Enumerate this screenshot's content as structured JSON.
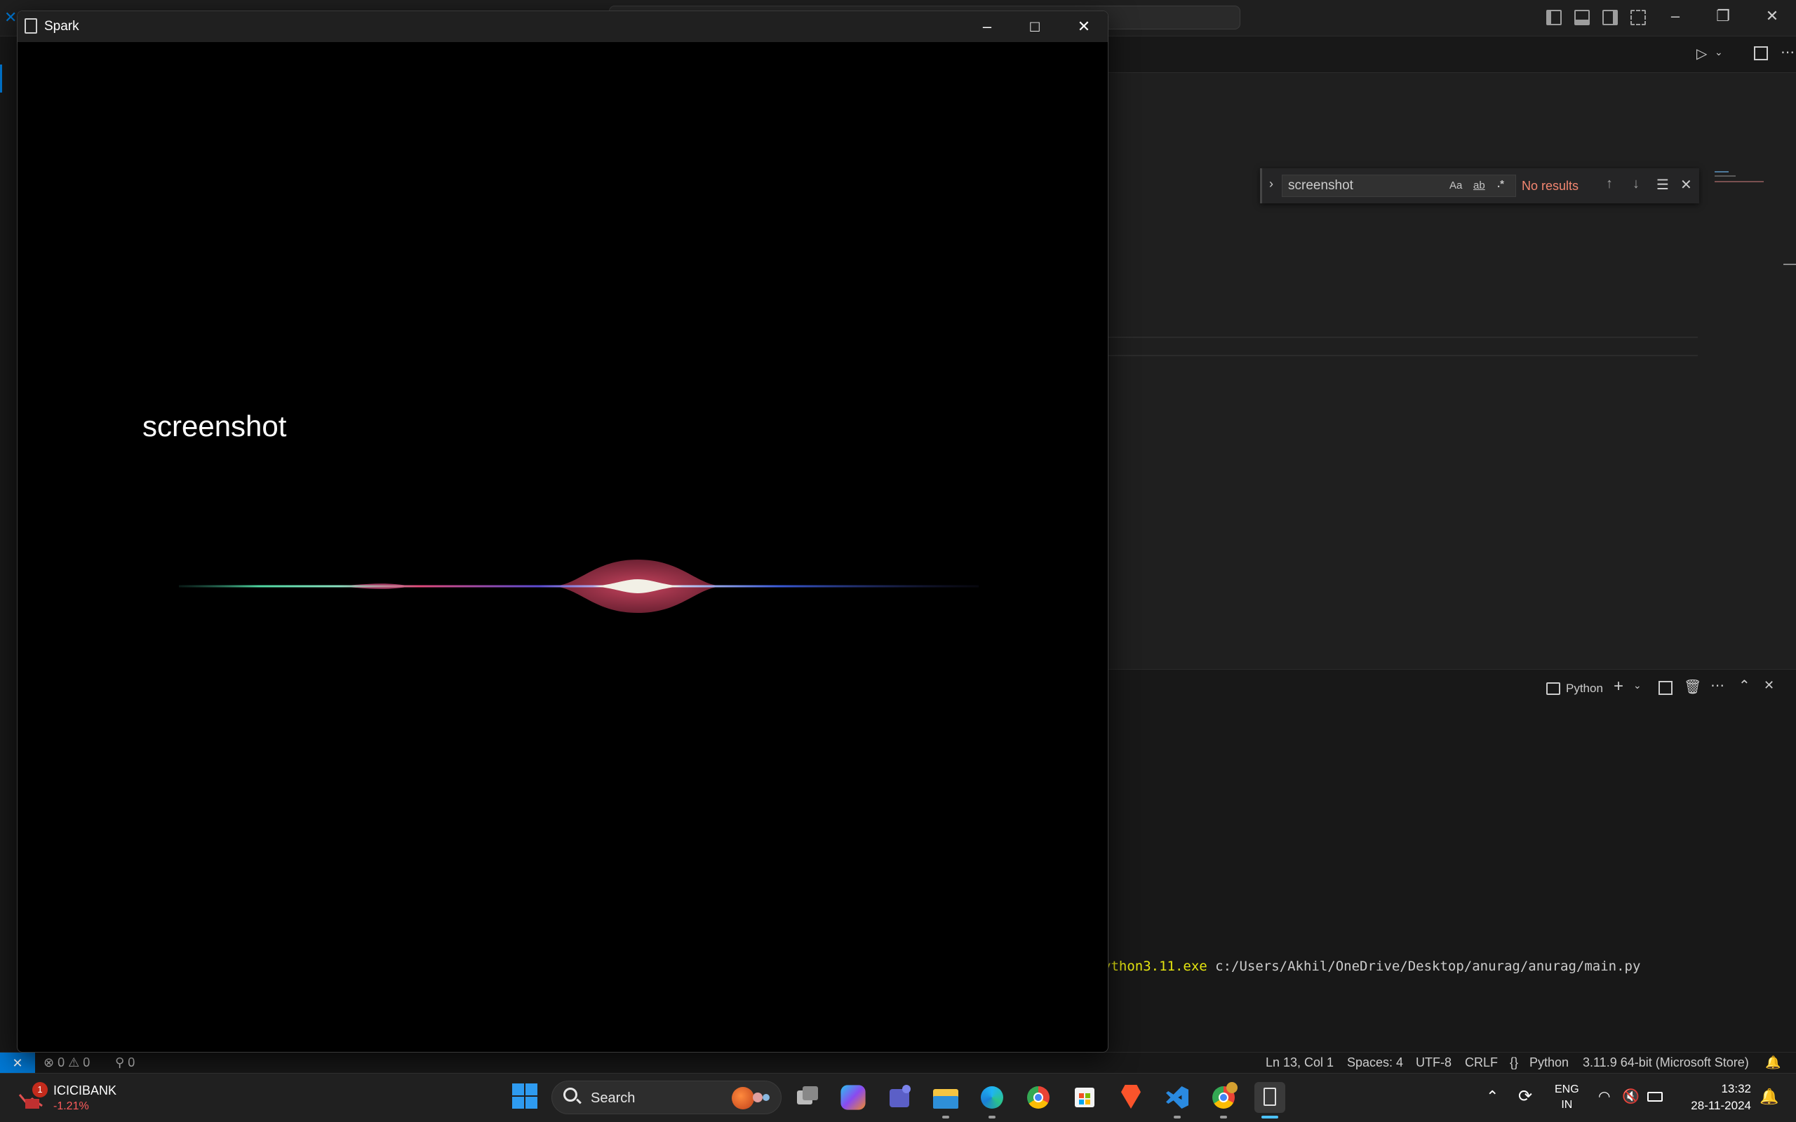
{
  "vscode": {
    "find": {
      "query": "screenshot",
      "match_case": "Aa",
      "whole_word": "ab",
      "regex": ".*",
      "status": "No results"
    },
    "panel": {
      "terminal_profile": "Python"
    },
    "terminal": {
      "exe": "ython3.11.exe",
      "path": " c:/Users/Akhil/OneDrive/Desktop/anurag/anurag/main.py"
    },
    "status": {
      "errors": "0",
      "warnings": "0",
      "ports": "0",
      "position": "Ln 13, Col 1",
      "spaces": "Spaces: 4",
      "encoding": "UTF-8",
      "eol": "CRLF",
      "language_braces": "{}",
      "language": "Python",
      "interpreter": "3.11.9 64-bit (Microsoft Store)"
    }
  },
  "spark": {
    "title": "Spark",
    "recognized_text": "screenshot"
  },
  "taskbar": {
    "stock": {
      "badge": "1",
      "name": "ICICIBANK",
      "change": "-1.21%"
    },
    "search_label": "Search",
    "language": "ENG",
    "region": "IN",
    "time": "13:32",
    "date": "28-11-2024"
  },
  "colors": {
    "accent": "#0078d4",
    "no_results": "#f48771",
    "stock_down": "#ff5c5c",
    "terminal_exe": "#e5e510"
  }
}
